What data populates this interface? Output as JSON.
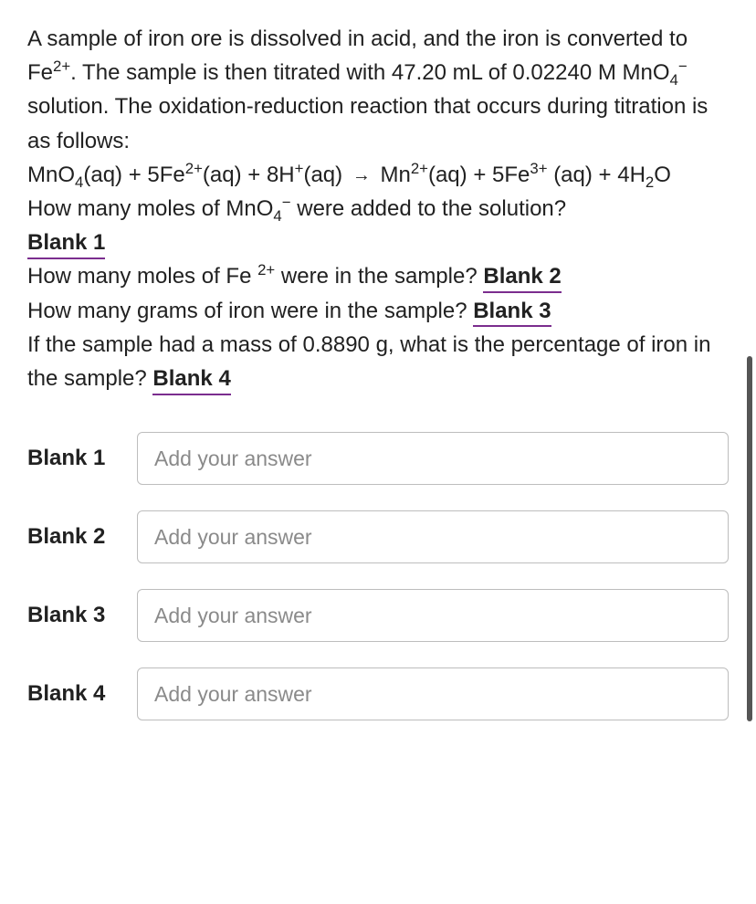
{
  "question": {
    "intro_part1": "A sample of iron ore is dissolved in acid, and the iron is converted to Fe",
    "intro_part2": ". The sample is then titrated with 47.20 mL of 0.02240 M MnO",
    "intro_part3": " solution. The oxidation-reduction reaction that occurs during titration is as follows:",
    "eq_mno4": "MnO",
    "eq_aq": "(aq)",
    "eq_plus": " + ",
    "eq_5fe": "5Fe",
    "eq_8h": "8H",
    "eq_mn": "Mn",
    "eq_5fe3": "5Fe",
    "eq_4h2o": "4H",
    "eq_o": "O",
    "q1": "How many moles of MnO",
    "q1_end": " were added to the solution?",
    "blank1": "Blank 1",
    "q2_start": "How many moles of Fe ",
    "q2_end": " were in the sample? ",
    "blank2": "Blank 2",
    "q3": "How many grams of iron were in the sample? ",
    "blank3": "Blank 3",
    "q4": "If the sample had a mass of 0.8890 g, what is the percentage of iron in the sample? ",
    "blank4": "Blank 4"
  },
  "answers": {
    "blank1_label": "Blank 1",
    "blank2_label": "Blank 2",
    "blank3_label": "Blank 3",
    "blank4_label": "Blank 4",
    "placeholder": "Add your answer"
  }
}
